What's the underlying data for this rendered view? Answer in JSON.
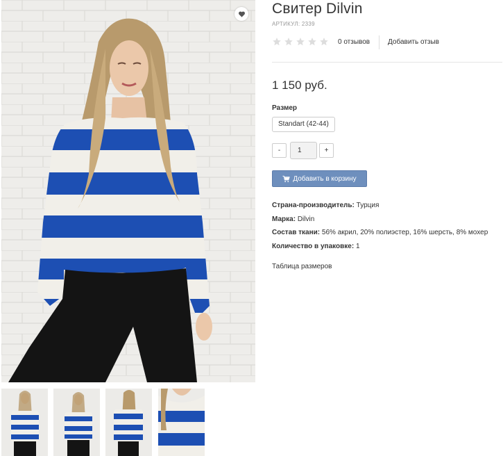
{
  "product": {
    "title": "Свитер Dilvin",
    "sku": "АРТИКУЛ: 2339",
    "rating": 0,
    "reviews_count": "0 отзывов",
    "add_review": "Добавить отзыв",
    "price": "1 150 руб.",
    "size_label": "Размер",
    "size_option": "Standart (42-44)",
    "qty_minus": "-",
    "qty_value": "1",
    "qty_plus": "+",
    "add_to_cart": "Добавить в корзину",
    "props": [
      {
        "label": "Страна-производитель:",
        "value": "Турция"
      },
      {
        "label": "Марка:",
        "value": "Dilvin"
      },
      {
        "label": "Состав ткани:",
        "value": "56% акрил, 20% полиэстер, 16% шерсть, 8% мохер"
      },
      {
        "label": "Количество в упаковке:",
        "value": "1"
      }
    ],
    "size_table_link": "Таблица размеров"
  },
  "gallery": {
    "thumbnails": [
      "front-view",
      "front-view-2",
      "back-view",
      "detail-closeup"
    ]
  },
  "icons": {
    "wishlist": "heart-icon",
    "cart": "cart-icon",
    "star": "star-icon"
  },
  "colors": {
    "accent_button": "#6e8fbd",
    "star_empty": "#dddddd",
    "stripe_blue": "#1d4fb3",
    "stripe_white": "#f1efe9"
  }
}
